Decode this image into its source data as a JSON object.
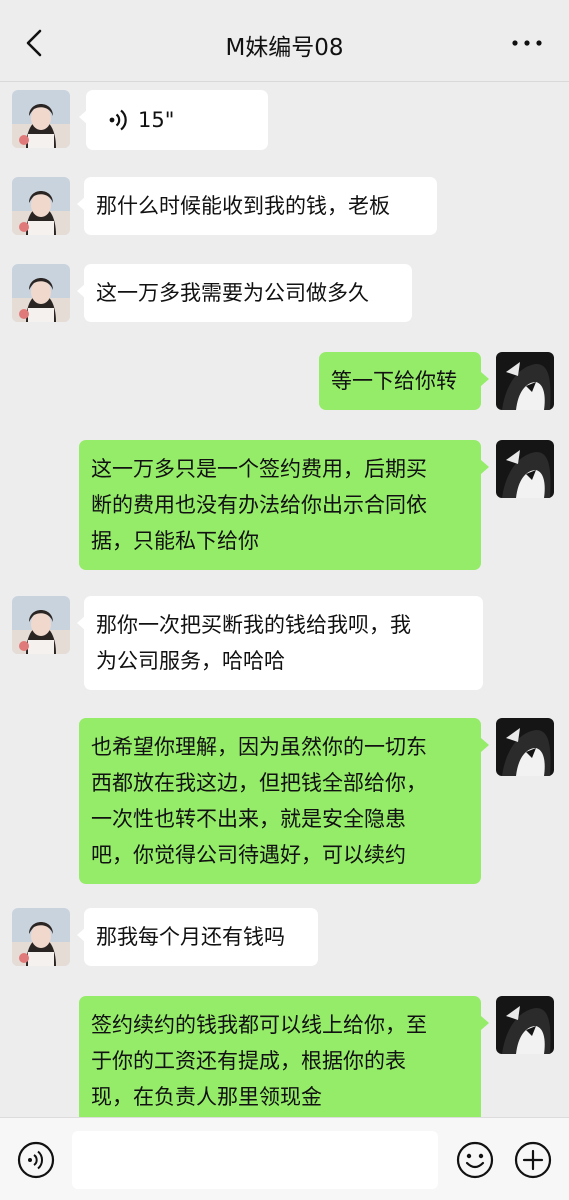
{
  "header": {
    "title": "M妹编号08",
    "back_icon": "chevron-left-icon",
    "more_icon": "more-dots-icon"
  },
  "messages": [
    {
      "side": "in",
      "type": "voice",
      "text": "15\""
    },
    {
      "side": "in",
      "type": "text",
      "text": "那什么时候能收到我的钱，老板"
    },
    {
      "side": "in",
      "type": "text",
      "text": "这一万多我需要为公司做多久"
    },
    {
      "side": "out",
      "type": "text",
      "text": "等一下给你转"
    },
    {
      "side": "out",
      "type": "text",
      "lines": [
        "这一万多只是一个签约费用，后期买",
        "断的费用也没有办法给你出示合同依",
        "据，只能私下给你"
      ]
    },
    {
      "side": "in",
      "type": "text",
      "lines": [
        "那你一次把买断我的钱给我呗，我",
        "为公司服务，哈哈哈"
      ]
    },
    {
      "side": "out",
      "type": "text",
      "lines": [
        "也希望你理解，因为虽然你的一切东",
        "西都放在我这边，但把钱全部给你，",
        "一次性也转不出来，就是安全隐患",
        "吧，你觉得公司待遇好，可以续约"
      ]
    },
    {
      "side": "in",
      "type": "text",
      "text": "那我每个月还有钱吗"
    },
    {
      "side": "out",
      "type": "text",
      "lines": [
        "签约续约的钱我都可以线上给你，至",
        "于你的工资还有提成，根据你的表",
        "现，在负责人那里领现金"
      ]
    }
  ],
  "input_bar": {
    "input_value": "",
    "icons": [
      "voice-icon",
      "emoji-icon",
      "plus-icon"
    ]
  },
  "colors": {
    "background": "#ededed",
    "incoming_bubble": "#ffffff",
    "outgoing_bubble": "#95ec69"
  }
}
